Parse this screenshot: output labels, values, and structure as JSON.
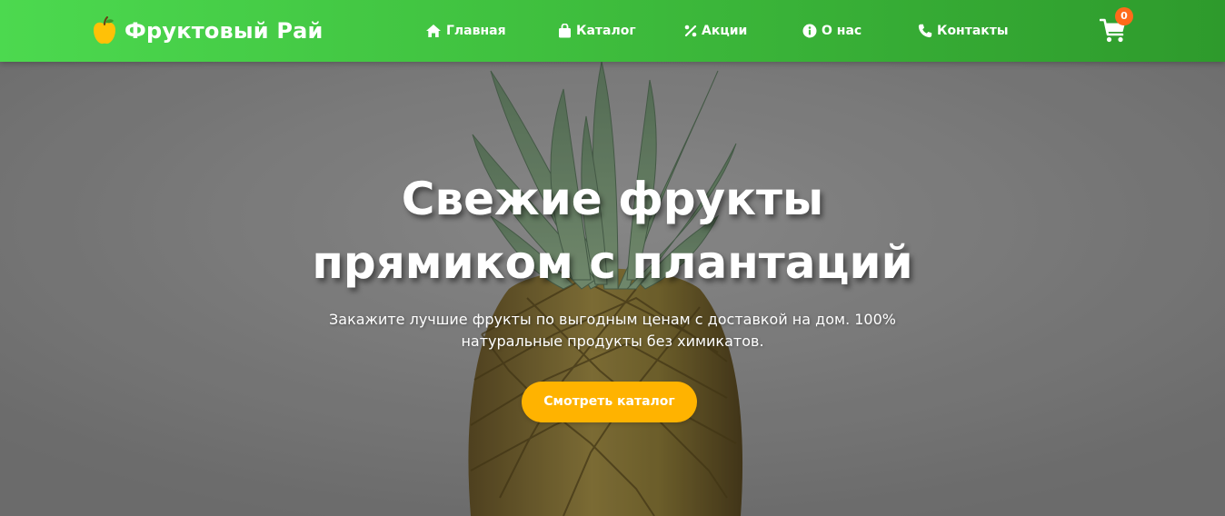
{
  "header": {
    "logo_text": "Фруктовый Рай",
    "logo_icon": "apple-icon",
    "nav": [
      {
        "label": "Главная",
        "icon": "home-icon"
      },
      {
        "label": "Каталог",
        "icon": "shopping-bag-icon"
      },
      {
        "label": "Акции",
        "icon": "percent-icon"
      },
      {
        "label": "О нас",
        "icon": "info-circle-icon"
      },
      {
        "label": "Контакты",
        "icon": "phone-icon"
      }
    ],
    "cart": {
      "icon": "cart-icon",
      "count": "0"
    }
  },
  "hero": {
    "title_line1": "Свежие фрукты",
    "title_line2": "прямиком с плантаций",
    "subtitle_line1": "Закажите лучшие фрукты по выгодным ценам с доставкой на дом. 100%",
    "subtitle_line2": "натуральные продукты без химикатов.",
    "button_label": "Смотреть каталог",
    "background_image": "pineapple-photo"
  },
  "colors": {
    "header_gradient_start": "#4cd94f",
    "header_gradient_end": "#2e9a2c",
    "accent_button": "#ffb300",
    "cart_badge": "#ff6a1a",
    "logo_apple": "#ffc107",
    "hero_background": "#8b8b8b"
  }
}
